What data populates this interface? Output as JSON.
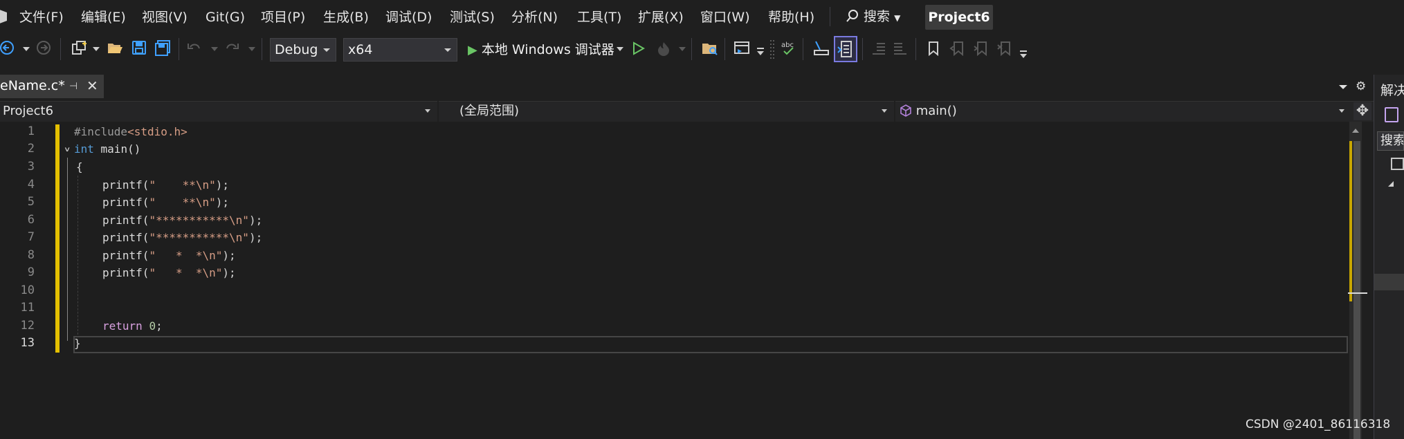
{
  "menu": {
    "items": [
      {
        "label": "文件(F)"
      },
      {
        "label": "编辑(E)"
      },
      {
        "label": "视图(V)"
      },
      {
        "label": "Git(G)"
      },
      {
        "label": "项目(P)"
      },
      {
        "label": "生成(B)"
      },
      {
        "label": "调试(D)"
      },
      {
        "label": "测试(S)"
      },
      {
        "label": "分析(N)"
      },
      {
        "label": "工具(T)"
      },
      {
        "label": "扩展(X)"
      },
      {
        "label": "窗口(W)"
      },
      {
        "label": "帮助(H)"
      }
    ],
    "search_label": "搜索",
    "project_name": "Project6"
  },
  "toolbar": {
    "configuration": "Debug",
    "platform": "x64",
    "run_label": "本地 Windows 调试器"
  },
  "tab": {
    "title": "eName.c*",
    "pin_glyph": "⊣",
    "close_glyph": "✕"
  },
  "navbar": {
    "project": "Project6",
    "scope": "(全局范围)",
    "member": "main()"
  },
  "editor": {
    "line_numbers": [
      "1",
      "2",
      "3",
      "4",
      "5",
      "6",
      "7",
      "8",
      "9",
      "10",
      "11",
      "12",
      "13"
    ],
    "current_line": "13",
    "lines": {
      "l1": {
        "directive": "#include",
        "header": "<stdio.h>"
      },
      "l2": {
        "kw": "int",
        "rest": " main()"
      },
      "l3": {
        "text": "{"
      },
      "l4": {
        "fn": "printf(",
        "str": "\"    **\\n\"",
        "end": ");"
      },
      "l5": {
        "fn": "printf(",
        "str": "\"    **\\n\"",
        "end": ");"
      },
      "l6": {
        "fn": "printf(",
        "str": "\"***********\\n\"",
        "end": ");"
      },
      "l7": {
        "fn": "printf(",
        "str": "\"***********\\n\"",
        "end": ");"
      },
      "l8": {
        "fn": "printf(",
        "str": "\"   *  *\\n\"",
        "end": ");"
      },
      "l9": {
        "fn": "printf(",
        "str": "\"   *  *\\n\"",
        "end": ");"
      },
      "l12": {
        "kw": "return",
        "num": "0",
        "end": ";"
      },
      "l13": {
        "text": "}"
      }
    }
  },
  "right_panel": {
    "title": "解决方案资源管理器",
    "search": "搜索"
  },
  "watermark": "CSDN @2401_86116318",
  "colors": {
    "background": "#1f1f1f",
    "editor_bg": "#1e1e1e",
    "keyword": "#569cd6",
    "string": "#d69d85",
    "return_keyword": "#d8a0df",
    "change_marker": "#e4c000"
  }
}
